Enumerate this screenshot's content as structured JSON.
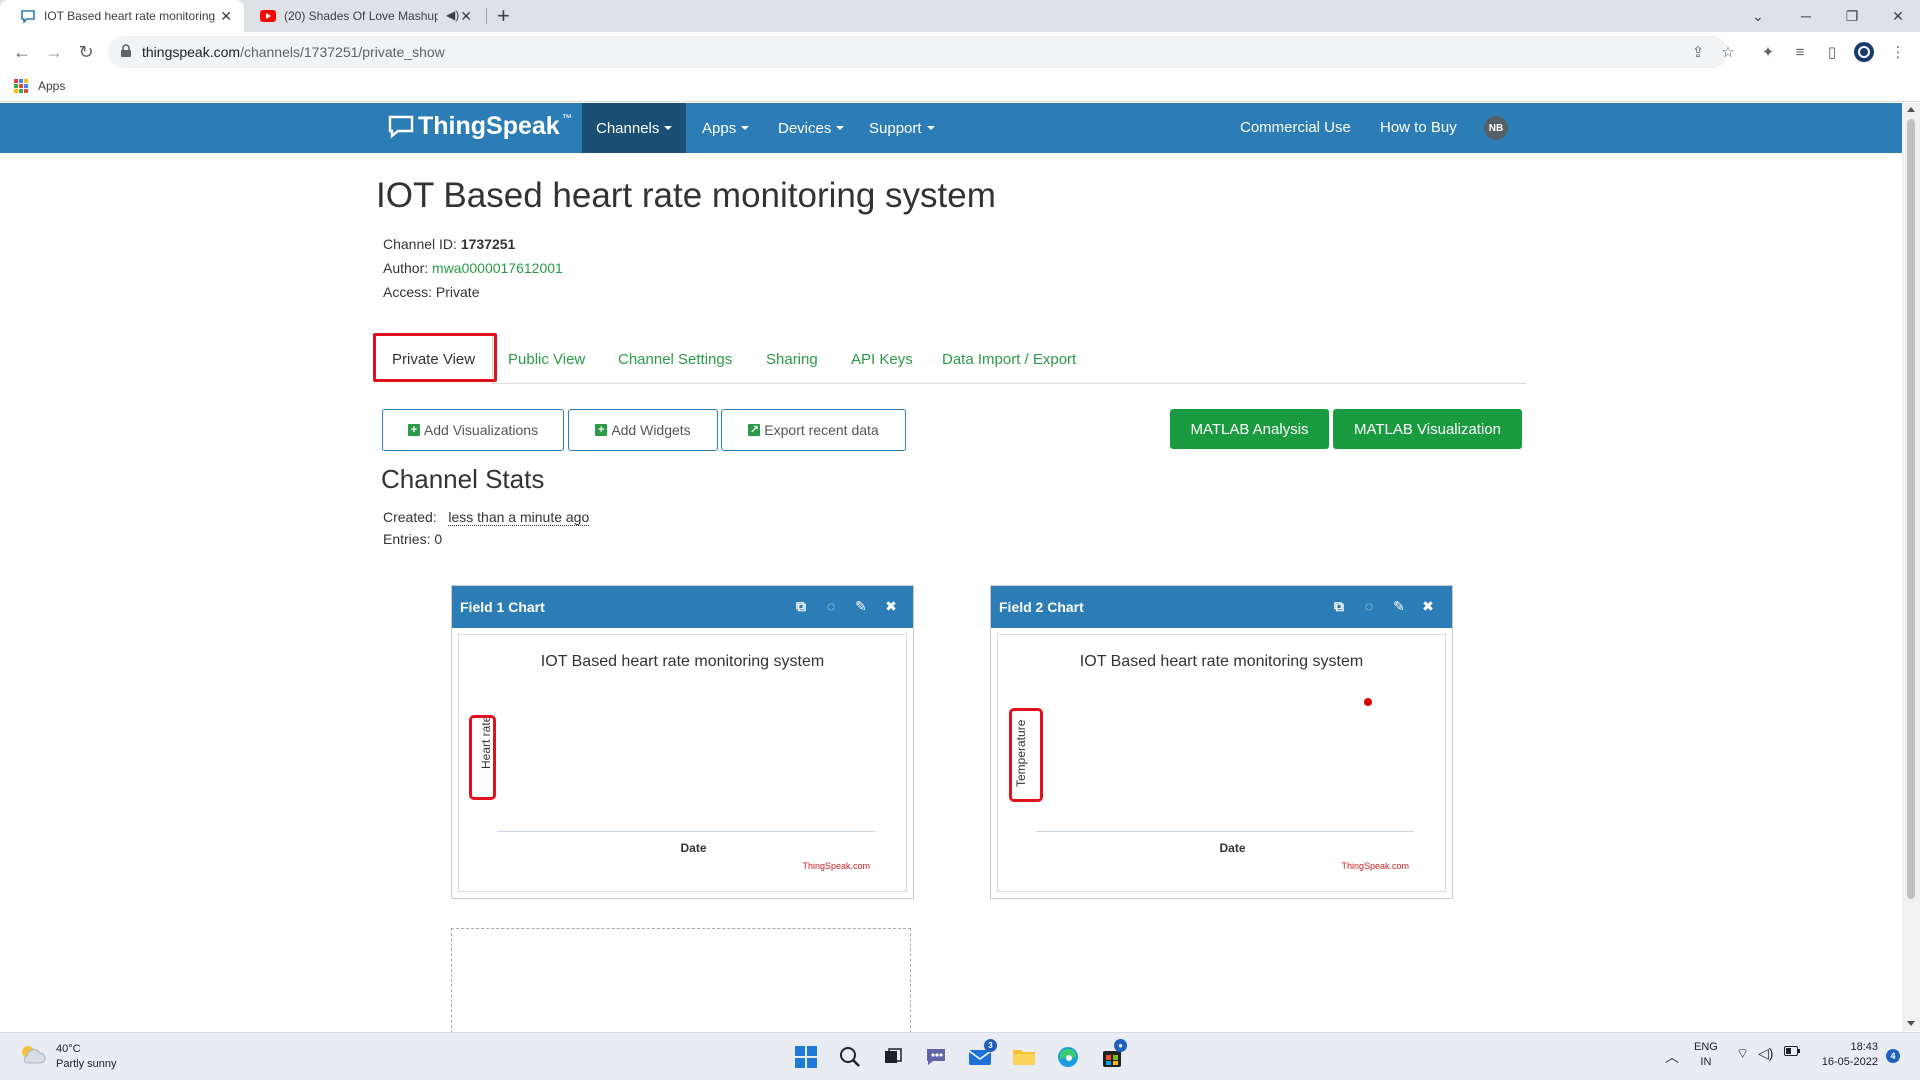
{
  "browser": {
    "tabs": [
      {
        "title": "IOT Based heart rate monitoring",
        "active": true,
        "favicon": "thingspeak-favicon"
      },
      {
        "title": "(20) Shades Of Love Mashup",
        "active": false,
        "favicon": "youtube-favicon",
        "muted_icon": "speaker-icon"
      }
    ],
    "url_host": "thingspeak.com",
    "url_path": "/channels/1737251/private_show",
    "bookmarks": {
      "apps_label": "Apps"
    }
  },
  "navbar": {
    "logo_text": "ThingSpeak",
    "logo_tm": "™",
    "menus": [
      "Channels",
      "Apps",
      "Devices",
      "Support"
    ],
    "right_links": [
      "Commercial Use",
      "How to Buy"
    ],
    "avatar_initials": "NB",
    "bar_color": "#2c7db5"
  },
  "channel": {
    "title": "IOT Based heart rate monitoring system",
    "id_label": "Channel ID:",
    "id_value": "1737251",
    "author_label": "Author:",
    "author_value": "mwa0000017612001",
    "access_label": "Access:",
    "access_value": "Private"
  },
  "channel_tabs": [
    "Private View",
    "Public View",
    "Channel Settings",
    "Sharing",
    "API Keys",
    "Data Import / Export"
  ],
  "actions": {
    "add_visualizations": "Add Visualizations",
    "add_widgets": "Add Widgets",
    "export_recent": "Export recent data",
    "matlab_analysis": "MATLAB Analysis",
    "matlab_visualization": "MATLAB Visualization"
  },
  "stats": {
    "heading": "Channel Stats",
    "created_label": "Created:",
    "created_value": "less than a minute ago",
    "entries_label": "Entries:",
    "entries_value": "0"
  },
  "widgets": [
    {
      "header": "Field 1 Chart",
      "chart_title": "IOT Based heart rate monitoring system",
      "ylabel": "Heart rate",
      "xlabel": "Date",
      "credit": "ThingSpeak.com"
    },
    {
      "header": "Field 2 Chart",
      "chart_title": "IOT Based heart rate monitoring system",
      "ylabel": "Temperature",
      "xlabel": "Date",
      "credit": "ThingSpeak.com"
    }
  ],
  "taskbar": {
    "temperature": "40°C",
    "weather": "Partly sunny",
    "mail_badge": "3",
    "language_top": "ENG",
    "language_bottom": "IN",
    "time": "18:43",
    "date": "16-05-2022",
    "notification_count": "4"
  }
}
